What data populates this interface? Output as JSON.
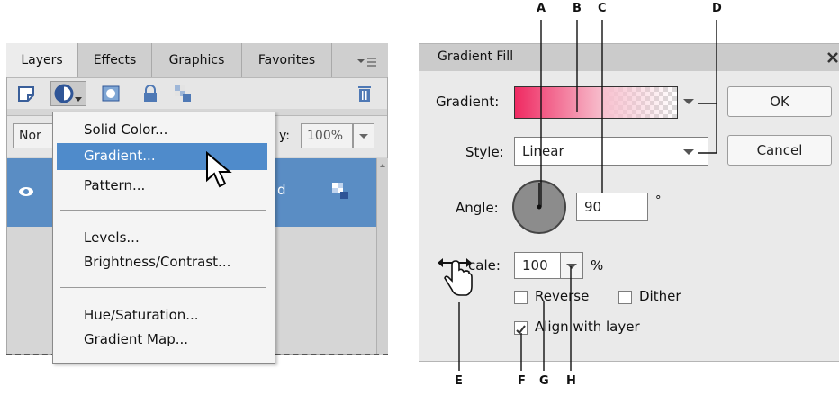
{
  "callouts": [
    "A",
    "B",
    "C",
    "D",
    "E",
    "F",
    "G",
    "H"
  ],
  "layers_panel": {
    "tabs": [
      "Layers",
      "Effects",
      "Graphics",
      "Favorites"
    ],
    "blend_mode_partial": "Nor",
    "opacity_partial": "y:",
    "opacity_value": "100%",
    "layer_name_partial": "d",
    "menu_items": [
      "Solid Color...",
      "Gradient...",
      "Pattern...",
      "Levels...",
      "Brightness/Contrast...",
      "Hue/Saturation...",
      "Gradient Map..."
    ],
    "highlighted_item": "Gradient..."
  },
  "gradient_dialog": {
    "title": "Gradient Fill",
    "gradient_label": "Gradient:",
    "style_label": "Style:",
    "style_value": "Linear",
    "angle_label": "Angle:",
    "angle_value": "90",
    "angle_unit": "°",
    "scale_label_partial": "cale:",
    "scale_value": "100",
    "scale_unit": "%",
    "reverse_label": "Reverse",
    "dither_label": "Dither",
    "align_label": "Align with layer",
    "align_checked": true,
    "reverse_checked": false,
    "dither_checked": false,
    "ok_label": "OK",
    "cancel_label": "Cancel",
    "gradient_colors": [
      "#ef2a62",
      "#f7c1cf"
    ]
  }
}
